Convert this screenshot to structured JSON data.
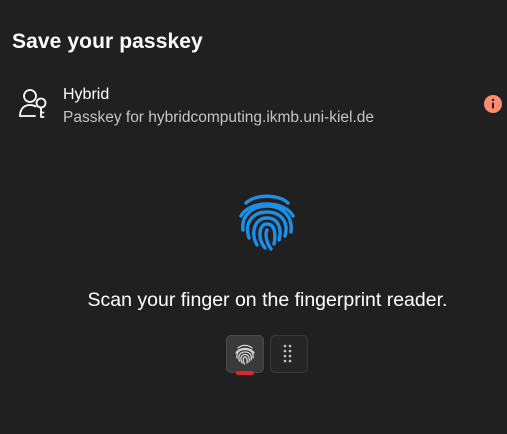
{
  "dialog": {
    "title": "Save your passkey"
  },
  "account": {
    "icon": "passkey-key-person-icon",
    "name": "Hybrid",
    "detail": "Passkey for hybridcomputing.ikmb.uni-kiel.de",
    "info_icon": "info-icon"
  },
  "verification": {
    "icon": "fingerprint-icon",
    "instruction": "Scan your finger on the fingerprint reader.",
    "methods": [
      {
        "name": "fingerprint",
        "icon": "fingerprint-icon",
        "selected": true
      },
      {
        "name": "pin",
        "icon": "keypad-icon",
        "selected": false
      }
    ]
  },
  "colors": {
    "background": "#202020",
    "accent_fingerprint": "#1e8fe6",
    "info_badge": "#ff8c72",
    "selected_indicator": "#e2242e",
    "secondary_text": "#c5c5c5"
  }
}
